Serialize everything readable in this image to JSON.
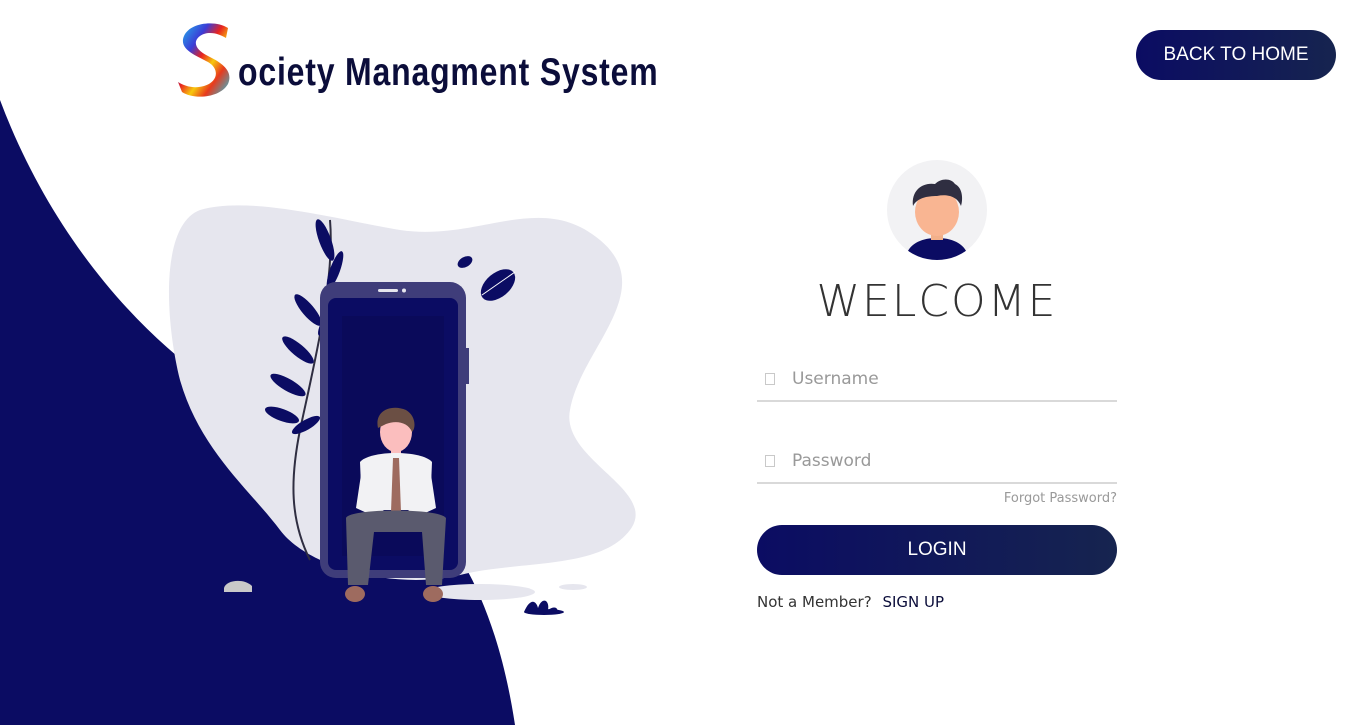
{
  "header": {
    "logo_letter": "S",
    "logo_text": "ociety Managment System",
    "back_home_label": "BACK TO HOME"
  },
  "login": {
    "title": "WELCOME",
    "username_placeholder": "Username",
    "password_placeholder": "Password",
    "forgot_label": "Forgot Password?",
    "login_label": "LOGIN",
    "not_member_label": "Not a Member?",
    "signup_label": "SIGN UP"
  },
  "icons": {
    "logo": "multicolor-s-logo-icon",
    "avatar": "user-avatar-icon",
    "username": "user-icon",
    "password": "lock-icon"
  },
  "colors": {
    "brand_navy": "#0b0c63",
    "button_gradient_end": "#16244f",
    "logo_text": "#0b0d3a",
    "blob_grey": "#e6e6ee"
  }
}
